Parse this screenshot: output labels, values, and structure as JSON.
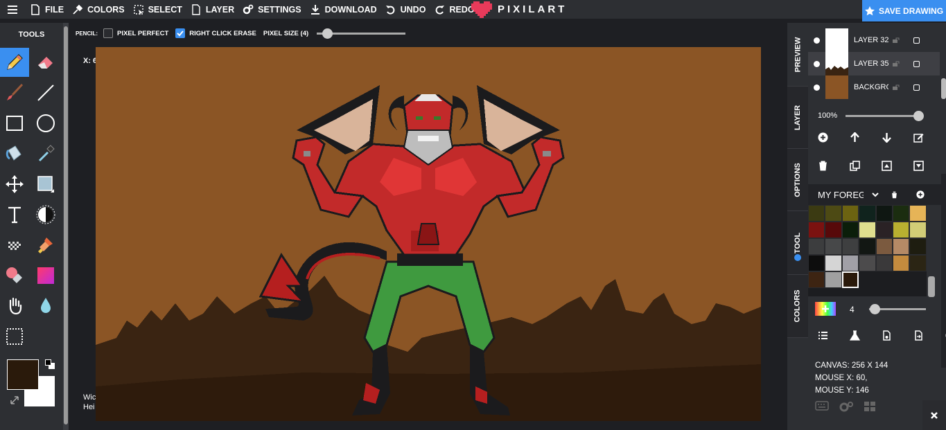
{
  "menu": {
    "file": "FILE",
    "colors": "COLORS",
    "select": "SELECT",
    "layer": "LAYER",
    "settings": "SETTINGS",
    "download": "DOWNLOAD",
    "undo": "UNDO",
    "redo": "REDO"
  },
  "logo": {
    "text": "PIXILART"
  },
  "save_label": "SAVE DRAWING",
  "tools_title": "TOOLS",
  "pencil_options": {
    "label": "PENCIL:",
    "pixel_perfect": "PIXEL PERFECT",
    "pixel_perfect_checked": false,
    "right_click_erase": "RIGHT CLICK ERASE",
    "right_click_erase_checked": true,
    "pixel_size_label": "PIXEL SIZE (4)"
  },
  "canvas_overlay": {
    "x_readout": "X: 6",
    "size_line1": "Wic",
    "size_line2": "Hei"
  },
  "side_tabs": {
    "preview": "PREVIEW",
    "layer": "LAYER",
    "options": "OPTIONS",
    "tool": "TOOL",
    "colors": "COLORS"
  },
  "layers": [
    {
      "name": "LAYER 32"
    },
    {
      "name": "LAYER 35"
    },
    {
      "name": "BACKGROUND"
    }
  ],
  "opacity": {
    "label": "100%",
    "value": 1.0
  },
  "palette": {
    "name": "MY FOREGROUND",
    "swatches": [
      "#3b3a12",
      "#4d4a14",
      "#6c6311",
      "#10231d",
      "#0f1712",
      "#1b2d10",
      "#e6b457",
      "#7b1210",
      "#57090a",
      "#0b1e0a",
      "#e0df8f",
      "#2a2225",
      "#b9b030",
      "#d2cd77",
      "#3c3d3e",
      "#474849",
      "#3e3f40",
      "#121713",
      "#7b5a3f",
      "#b58a66",
      "#1e1d10",
      "#0d0d0d",
      "#d5d5d5",
      "#a1a0a7",
      "#4c4b4c",
      "#3a393a",
      "#c48b3e",
      "#2b2514",
      "#3d2412",
      "#a0a0a0",
      "#2a1a0b"
    ]
  },
  "brush_size": {
    "value": "4",
    "fraction": 0.1
  },
  "status": {
    "canvas": "CANVAS: 256 X 144",
    "mouse_x": "MOUSE X: 60,",
    "mouse_y": "MOUSE Y: 146"
  },
  "primary_color": "#2a1a0b",
  "secondary_color": "#ffffff"
}
